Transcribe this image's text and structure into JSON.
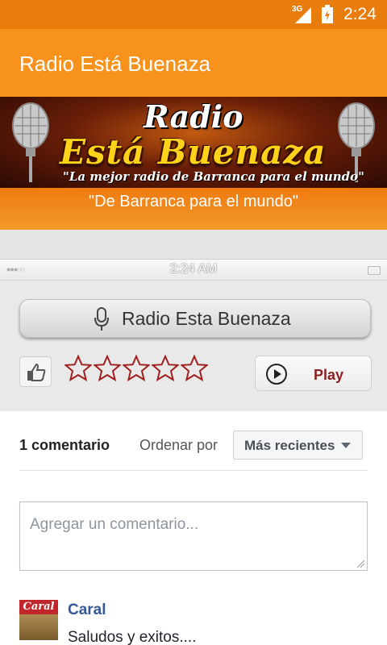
{
  "status_bar": {
    "network": "3G",
    "time": "2:24"
  },
  "app_bar": {
    "title": "Radio Está Buenaza"
  },
  "banner": {
    "radio_word": "Radio",
    "name_word": "Está Buenaza",
    "slogan": "\"La mejor radio de Barranca para el mundo\"",
    "tagline": "\"De Barranca para el mundo\""
  },
  "player": {
    "status_time": "2:24 AM",
    "station_label": "Radio Esta Buenaza",
    "rating": {
      "value": 0,
      "max": 5
    },
    "play_label": "Play"
  },
  "comments": {
    "count_label": "1 comentario",
    "order_label": "Ordenar por",
    "sort_selected": "Más recientes",
    "input_placeholder": "Agregar un comentario...",
    "items": [
      {
        "avatar_text": "Caral",
        "author": "Caral",
        "text": "Saludos y exitos...."
      }
    ]
  },
  "colors": {
    "status_bar": "#e87d0d",
    "app_bar": "#f7931d",
    "star_outline": "#a02020",
    "link_blue": "#365899"
  }
}
